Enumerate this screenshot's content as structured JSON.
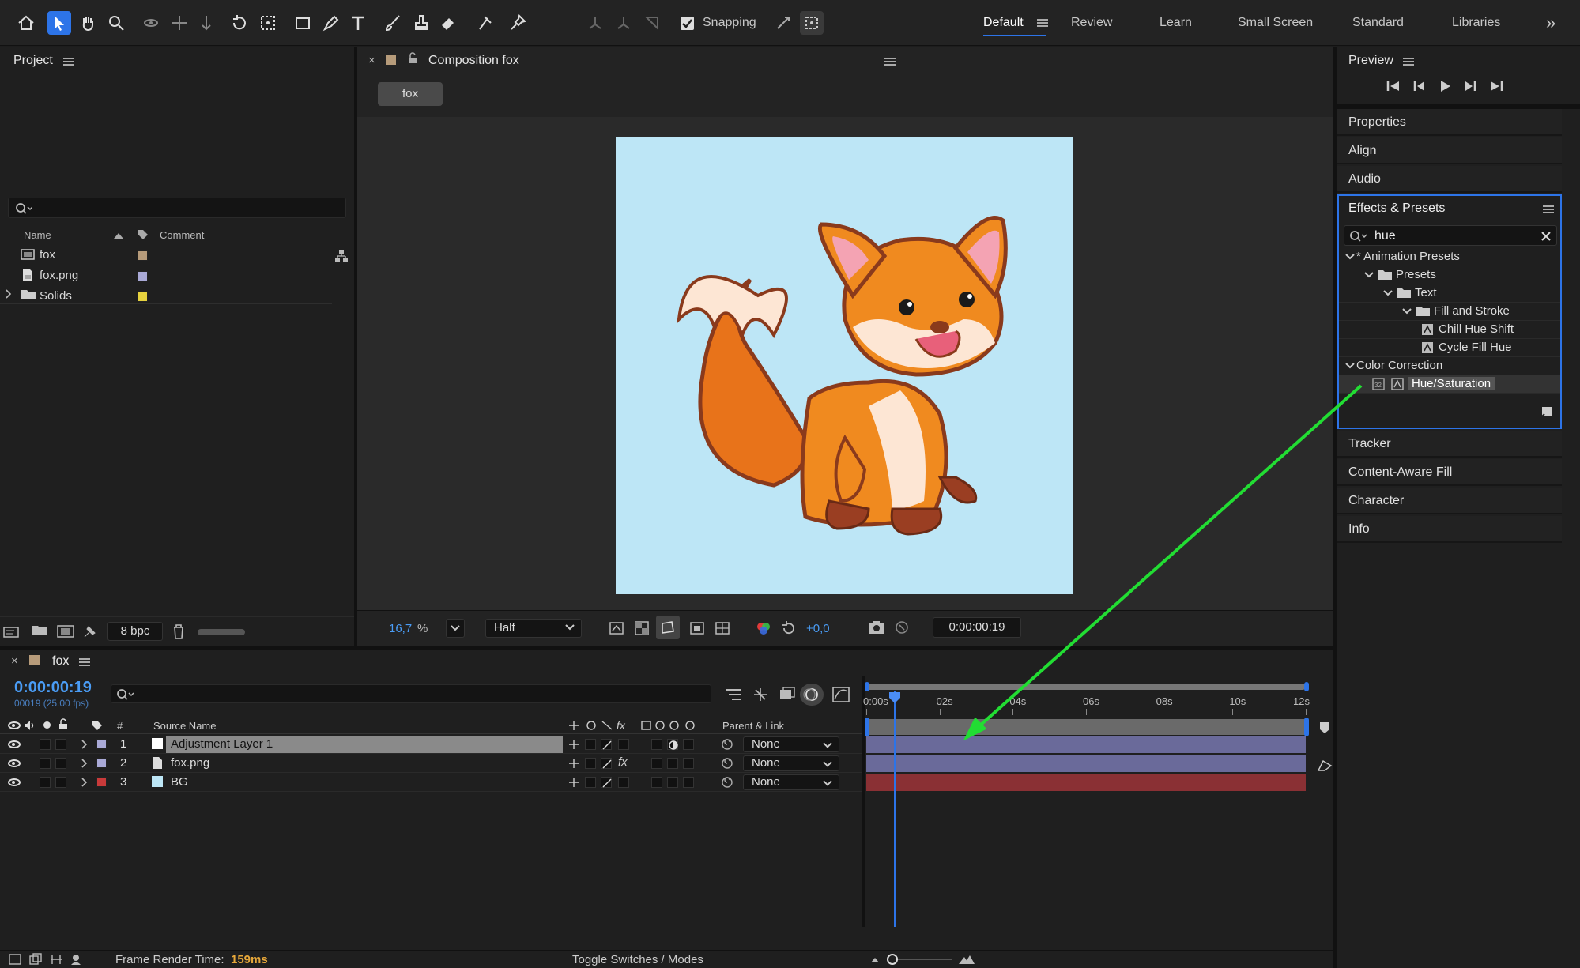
{
  "toolbar": {
    "snapping_label": "Snapping",
    "workspaces": [
      "Default",
      "Review",
      "Learn",
      "Small Screen",
      "Standard",
      "Libraries"
    ],
    "overflow": "»"
  },
  "project": {
    "title": "Project",
    "search_placeholder": "",
    "col_name": "Name",
    "col_comment": "Comment",
    "items": [
      {
        "name": "fox",
        "color": "#b69b7a"
      },
      {
        "name": "fox.png",
        "color": "#a9a9d6"
      },
      {
        "name": "Solids",
        "color": "#e6d23e"
      }
    ],
    "bpc": "8 bpc"
  },
  "composition": {
    "tab_title": "Composition fox",
    "breadcrumb": "fox",
    "zoom": "16,7",
    "zoom_unit": "%",
    "resolution": "Half",
    "exposure": "+0,0",
    "timecode": "0:00:00:19",
    "bg_color": "#bde6f6"
  },
  "preview": {
    "title": "Preview"
  },
  "side_sections": [
    "Properties",
    "Align",
    "Audio"
  ],
  "effects": {
    "title": "Effects & Presets",
    "search_value": "hue",
    "tree": [
      {
        "label": "* Animation Presets",
        "level": 0,
        "type": "folder-open"
      },
      {
        "label": "Presets",
        "level": 1,
        "type": "folder-open"
      },
      {
        "label": "Text",
        "level": 2,
        "type": "folder-open"
      },
      {
        "label": "Fill and Stroke",
        "level": 3,
        "type": "folder-open"
      },
      {
        "label": "Chill Hue Shift",
        "level": 4,
        "type": "preset"
      },
      {
        "label": "Cycle Fill Hue",
        "level": 4,
        "type": "preset"
      },
      {
        "label": "Color Correction",
        "level": 0,
        "type": "category"
      },
      {
        "label": "Hue/Saturation",
        "level": 1,
        "type": "effect",
        "selected": true
      }
    ]
  },
  "side_sections_lower": [
    "Tracker",
    "Content-Aware Fill",
    "Character",
    "Info"
  ],
  "timeline": {
    "comp_name": "fox",
    "timecode": "0:00:00:19",
    "frame_info": "00019 (25.00 fps)",
    "col_source": "Source Name",
    "col_num": "#",
    "col_parent": "Parent & Link",
    "ticks": [
      "0:00s",
      "02s",
      "04s",
      "06s",
      "08s",
      "10s",
      "12s"
    ],
    "layers": [
      {
        "num": "1",
        "name": "Adjustment Layer 1",
        "label_color": "#a9a9d6",
        "parent": "None",
        "bar_color": "#6a6a9a"
      },
      {
        "num": "2",
        "name": "fox.png",
        "label_color": "#a9a9d6",
        "parent": "None",
        "bar_color": "#6a6a9a"
      },
      {
        "num": "3",
        "name": "BG",
        "label_color": "#c83a3a",
        "parent": "None",
        "bar_color": "#8a3034"
      }
    ],
    "playhead_seconds": 0.76,
    "duration_seconds": 12
  },
  "status": {
    "render_label": "Frame Render Time:",
    "render_value": "159ms",
    "toggle": "Toggle Switches / Modes"
  },
  "annotation": {
    "arrow_color": "#22dd33"
  }
}
